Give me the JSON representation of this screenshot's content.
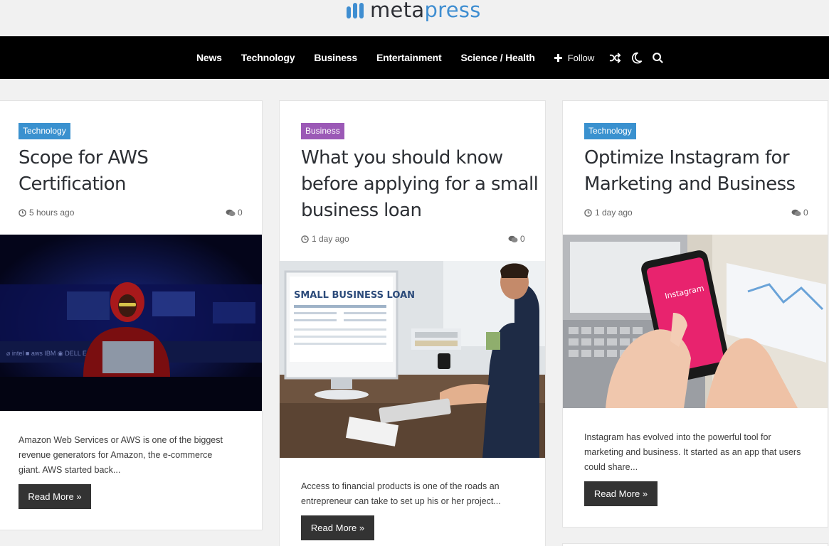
{
  "logo": {
    "part1": "meta",
    "part2": "press"
  },
  "nav": {
    "items": [
      "News",
      "Technology",
      "Business",
      "Entertainment",
      "Science / Health"
    ],
    "follow_label": "Follow"
  },
  "cards": [
    {
      "category": "Technology",
      "title_lines": [
        "Scope for AWS",
        "Certification"
      ],
      "time": "5 hours ago",
      "comments": "0",
      "excerpt_lines": [
        "Amazon Web Services or AWS is one of the biggest",
        "revenue generators for Amazon, the e-commerce",
        "giant. AWS started back..."
      ],
      "button": "Read More »"
    },
    {
      "category": "Business",
      "title_lines": [
        "What you should know",
        "before applying for a small",
        "business loan"
      ],
      "time": "1 day ago",
      "comments": "0",
      "image_text": "SMALL BUSINESS LOAN",
      "excerpt_lines": [
        "Access to financial products is one of the roads an",
        "entrepreneur can take to set up his or her project..."
      ],
      "button": "Read More »"
    },
    {
      "category": "Technology",
      "title_lines": [
        "Optimize Instagram for",
        "Marketing and Business"
      ],
      "time": "1 day ago",
      "comments": "0",
      "image_text": "Instagram",
      "excerpt_lines": [
        "Instagram has evolved into the powerful tool for",
        "marketing and business. It started as an app that users",
        "could share..."
      ],
      "button": "Read More »"
    }
  ],
  "colors": {
    "tech_badge": "#3a91cf",
    "business_badge": "#9b59b6",
    "nav_bg": "#000000",
    "logo_accent": "#3f8ed1"
  }
}
